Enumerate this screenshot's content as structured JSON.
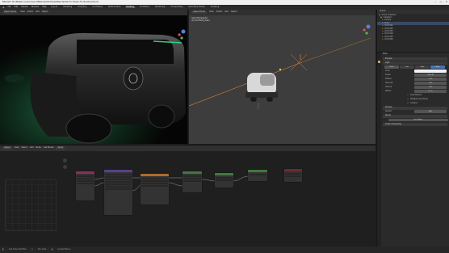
{
  "window": {
    "title": "Blender* [D:\\Master Lorem Ipsum\\Blender\\02-Model\\Render\\02 Pro Study For Render.blend]",
    "controls": [
      "—",
      "□",
      "✕"
    ]
  },
  "menubar": {
    "menus": [
      "File",
      "Edit",
      "Render",
      "Window",
      "Help"
    ],
    "workspaces": [
      "Layout",
      "Modeling",
      "Sculpting",
      "UV Editing",
      "Texture Paint",
      "Shading",
      "Animation",
      "Rendering",
      "Compositing",
      "Geometry Nodes",
      "Scripting"
    ],
    "active_workspace": "Shading"
  },
  "viewport_left": {
    "mode": "Object Mode",
    "menus": [
      "View",
      "Select",
      "Add",
      "Object"
    ]
  },
  "viewport_right": {
    "mode": "Object Mode",
    "menus": [
      "View",
      "Select",
      "Add",
      "Object"
    ],
    "overlay_title": "User Orthographic",
    "overlay_subtitle": "(1) Point Body_Glass"
  },
  "outliner": {
    "title": "Scene",
    "items": [
      "Scene Collection",
      "Collection",
      "Camera",
      "Point",
      "Point.001",
      "Point.002",
      "Point.003",
      "Point.004",
      "Point.005",
      "Point.006"
    ]
  },
  "properties": {
    "object_name": "Point",
    "sections": {
      "preview": "Preview",
      "light": "Light",
      "shadow": "Shadow",
      "nodes": "Nodes",
      "custom": "Custom Properties"
    },
    "light_types": [
      "Point",
      "Sun",
      "Spot",
      "Area"
    ],
    "active_light_type": "Point",
    "fields": [
      {
        "label": "Color",
        "value": ""
      },
      {
        "label": "Power",
        "value": "1000 W"
      },
      {
        "label": "Diffuse",
        "value": "1.00"
      },
      {
        "label": "Specular",
        "value": "1.00"
      },
      {
        "label": "Volume",
        "value": "1.00"
      },
      {
        "label": "Radius",
        "value": "0.1 m"
      }
    ],
    "checkboxes": [
      {
        "label": "Cast Shadow",
        "checked": true
      },
      {
        "label": "Multiple Importance",
        "checked": true
      },
      {
        "label": "Caustics",
        "checked": false
      }
    ],
    "spread_label": "Spread",
    "spread_value": "180°",
    "nodes_button": "Use Nodes"
  },
  "node_editor": {
    "mode": "Object",
    "menus": [
      "View",
      "Select",
      "Add",
      "Node"
    ],
    "use_nodes_label": "Use Nodes",
    "slot": "World"
  },
  "statusbar": {
    "items": [
      "Set Active Modifier",
      "Pan View",
      "Context Menu"
    ]
  }
}
